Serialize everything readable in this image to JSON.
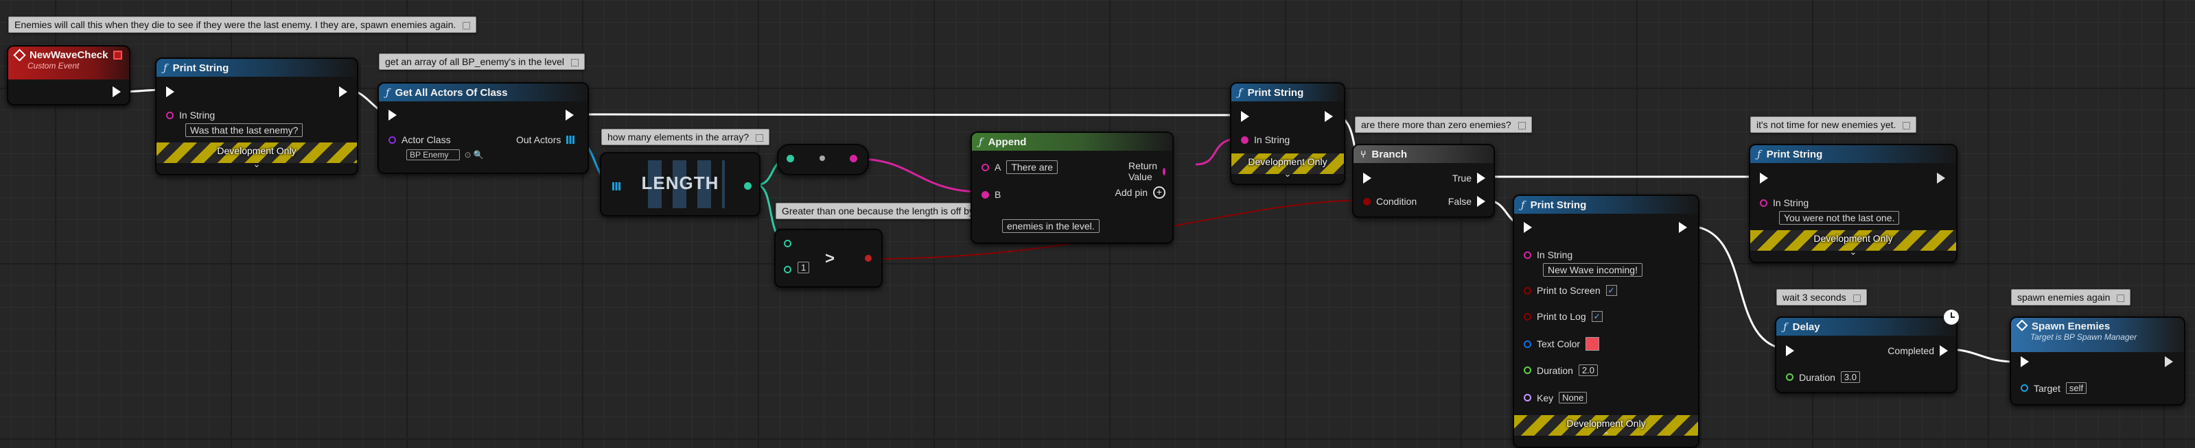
{
  "comments": {
    "top": "Enemies will call this when they die to see if they were the last enemy. I they are, spawn enemies again.",
    "get_array": "get an array of all BP_enemy's in the level",
    "how_many": "how many elements in the array?",
    "greater_than": "Greater than one because the length is off by one",
    "more_than_zero": "are there more than zero enemies?",
    "not_time": "it's not time for new enemies yet.",
    "wait": "wait 3 seconds",
    "spawn_again": "spawn enemies again"
  },
  "event": {
    "title": "NewWaveCheck",
    "subtitle": "Custom Event"
  },
  "print1": {
    "title": "Print String",
    "in_label": "In String",
    "value": "Was that the last enemy?",
    "dev": "Development Only"
  },
  "get_all": {
    "title": "Get All Actors Of Class",
    "class_label": "Actor Class",
    "class_value": "BP Enemy",
    "out_label": "Out Actors"
  },
  "length": {
    "title": "LENGTH"
  },
  "greater": {
    "symbol": ">",
    "value": "1"
  },
  "append": {
    "title": "Append",
    "a_label": "A",
    "a_value": "There are",
    "b_label": "B",
    "b_value": "enemies in the level.",
    "return_label": "Return Value",
    "add_pin": "Add pin"
  },
  "print2": {
    "title": "Print String",
    "in_label": "In String",
    "dev": "Development Only"
  },
  "branch": {
    "title": "Branch",
    "true_label": "True",
    "false_label": "False",
    "condition_label": "Condition"
  },
  "print3": {
    "title": "Print String",
    "in_label": "In String",
    "value": "You were not the last one.",
    "dev": "Development Only"
  },
  "print4": {
    "title": "Print String",
    "in_label": "In String",
    "value": "New Wave incoming!",
    "screen_label": "Print to Screen",
    "log_label": "Print to Log",
    "color_label": "Text Color",
    "text_color": "#ee4b55",
    "duration_label": "Duration",
    "duration_value": "2.0",
    "key_label": "Key",
    "key_value": "None",
    "dev": "Development Only"
  },
  "delay": {
    "title": "Delay",
    "completed_label": "Completed",
    "duration_label": "Duration",
    "duration_value": "3.0"
  },
  "spawn": {
    "title": "Spawn Enemies",
    "subtitle": "Target is BP Spawn Manager",
    "target_label": "Target",
    "target_value": "self"
  },
  "colors": {
    "exec": "#ffffff",
    "string": "#d6249f",
    "bool": "#8c0000",
    "int": "#2ec9a0",
    "object": "#1aa0e0",
    "event": "#b31b1b",
    "function": "#1d5b8e"
  }
}
